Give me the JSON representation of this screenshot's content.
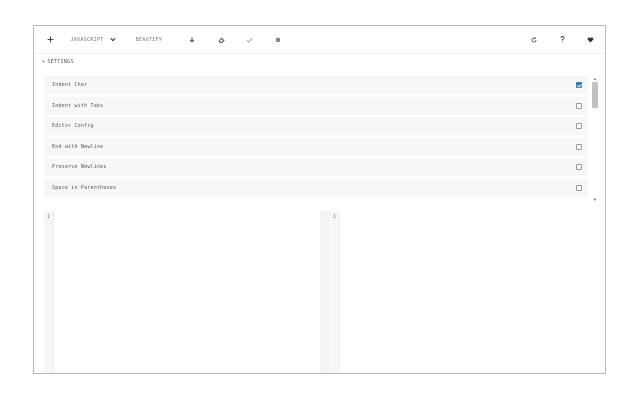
{
  "toolbar": {
    "add_icon": "plus-icon",
    "language_label": "JAVASCRIPT",
    "language_dropdown_icon": "chevron-down-icon",
    "beautify_label": "BEAUTIFY",
    "download_icon": "download-icon",
    "clear_icon": "eraser-icon",
    "copy_icon": "check-icon",
    "settings_icon": "gear-icon",
    "refresh_icon": "refresh-icon",
    "help_icon": "question-icon",
    "favorite_icon": "heart-icon"
  },
  "settings": {
    "header_caret": "▾",
    "header_label": "SETTINGS",
    "items": [
      {
        "label": "Indent Char",
        "checked": true
      },
      {
        "label": "Indent with Tabs",
        "checked": false
      },
      {
        "label": "Editor Config",
        "checked": false
      },
      {
        "label": "End with Newline",
        "checked": false
      },
      {
        "label": "Preserve Newlines",
        "checked": false
      },
      {
        "label": "Space in Parentheses",
        "checked": false
      }
    ]
  },
  "editors": {
    "input": {
      "line_number": "1",
      "content": ""
    },
    "output": {
      "line_number": "1",
      "content": ""
    }
  },
  "colors": {
    "accent": "#2f74c8",
    "row_background": "#f6f7f8",
    "border": "#b9b9b9"
  }
}
